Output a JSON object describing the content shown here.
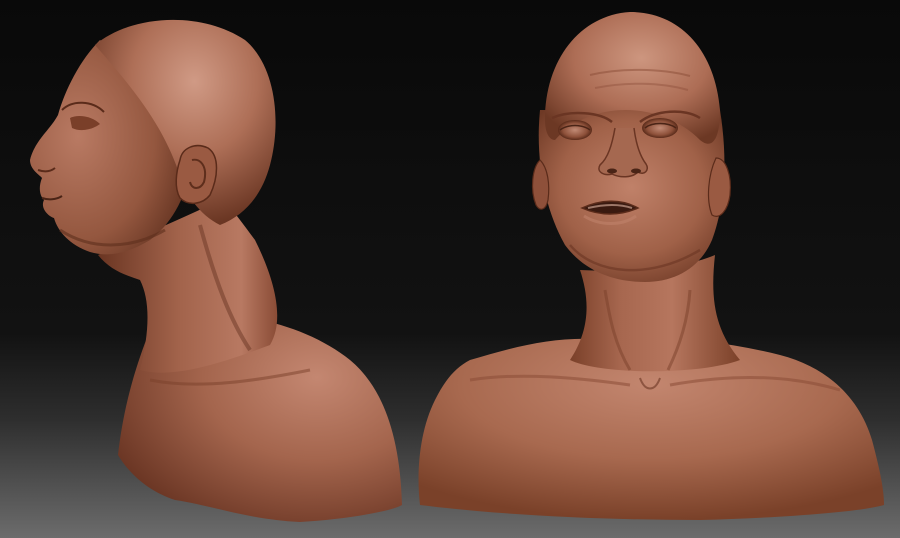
{
  "scene": {
    "colors": {
      "background_top": "#090909",
      "background_mid": "#141414",
      "background_bottom": "#6c6c6c",
      "skin_highlight": "#c88d78",
      "skin_mid": "#a86a53",
      "skin_shadow": "#6e3a27",
      "skin_dark": "#4a2416"
    },
    "models": [
      {
        "view": "side-profile-left"
      },
      {
        "view": "front-three-quarter"
      }
    ]
  }
}
